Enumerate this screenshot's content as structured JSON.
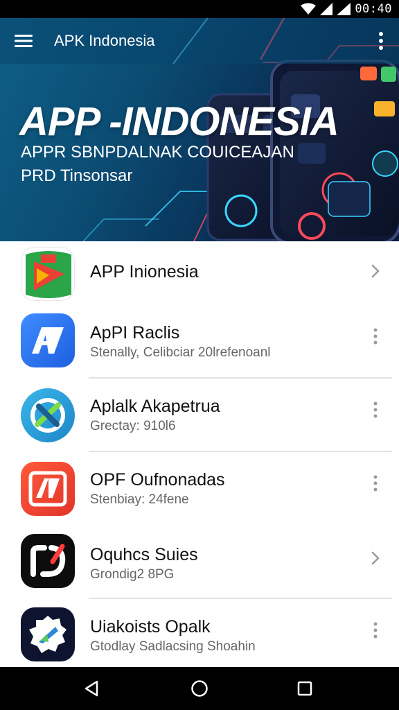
{
  "status_bar": {
    "time": "00:40"
  },
  "toolbar": {
    "title": "APK Indonesia"
  },
  "hero": {
    "title": "APP -INDONESIA",
    "subtitle_line1": "APPR SBNPDALNAK COUICEAJAN",
    "subtitle_line2": "PRD Tinsonsar"
  },
  "apps": [
    {
      "name": "APP Inionesia",
      "subtitle": "",
      "icon": "green-red-play-icon",
      "trailing": "chevron-right-icon"
    },
    {
      "name": "ApPI Raclis",
      "subtitle": "Stenally, Celibciar 20lrefenoanl",
      "icon": "blue-av-icon",
      "trailing": "more-vertical-icon"
    },
    {
      "name": "Aplalk Akapetrua",
      "subtitle": "Grectay: 910l6",
      "icon": "teal-x-icon",
      "trailing": "more-vertical-icon"
    },
    {
      "name": "OPF Oufnonadas",
      "subtitle": "Stenbiay: 24fene",
      "icon": "red-av-icon",
      "trailing": "more-vertical-icon"
    },
    {
      "name": "Oquhcs Suies",
      "subtitle": "Grondig2 8PG",
      "icon": "black-rd-icon",
      "trailing": "chevron-right-icon"
    },
    {
      "name": "Uiakoists Opalk",
      "subtitle": "Gtodlay Sadlacsing Shoahin",
      "icon": "navy-badge-icon",
      "trailing": "more-vertical-icon"
    }
  ],
  "colors": {
    "hero_dark": "#0b1a35",
    "hero_blue": "#0f5f86",
    "neon_red": "#ff3b3b",
    "neon_cyan": "#38d6ff"
  }
}
